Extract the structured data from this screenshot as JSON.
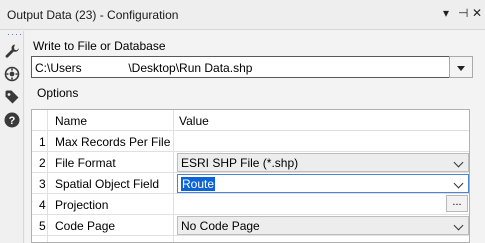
{
  "window": {
    "title": "Output Data (23) - Configuration",
    "controls": [
      "▾",
      "⊣",
      "✕"
    ]
  },
  "sidebar": {
    "icons": [
      "wrench-icon",
      "gear-circle-icon",
      "tag-icon",
      "help-icon"
    ]
  },
  "write": {
    "label": "Write to File or Database",
    "path": "C:\\Users              \\Desktop\\Run Data.shp"
  },
  "options": {
    "label": "Options",
    "columns": [
      "Name",
      "Value"
    ],
    "rows": [
      {
        "num": "1",
        "name": "Max Records Per File",
        "value": ""
      },
      {
        "num": "2",
        "name": "File Format",
        "value": "ESRI SHP File (*.shp)"
      },
      {
        "num": "3",
        "name": "Spatial Object Field",
        "value": "Route"
      },
      {
        "num": "4",
        "name": "Projection",
        "value": "",
        "button": "..."
      },
      {
        "num": "5",
        "name": "Code Page",
        "value": "No Code Page"
      }
    ]
  },
  "colors": {
    "selection": "#0a64d8",
    "help": "#1f4e8c"
  }
}
